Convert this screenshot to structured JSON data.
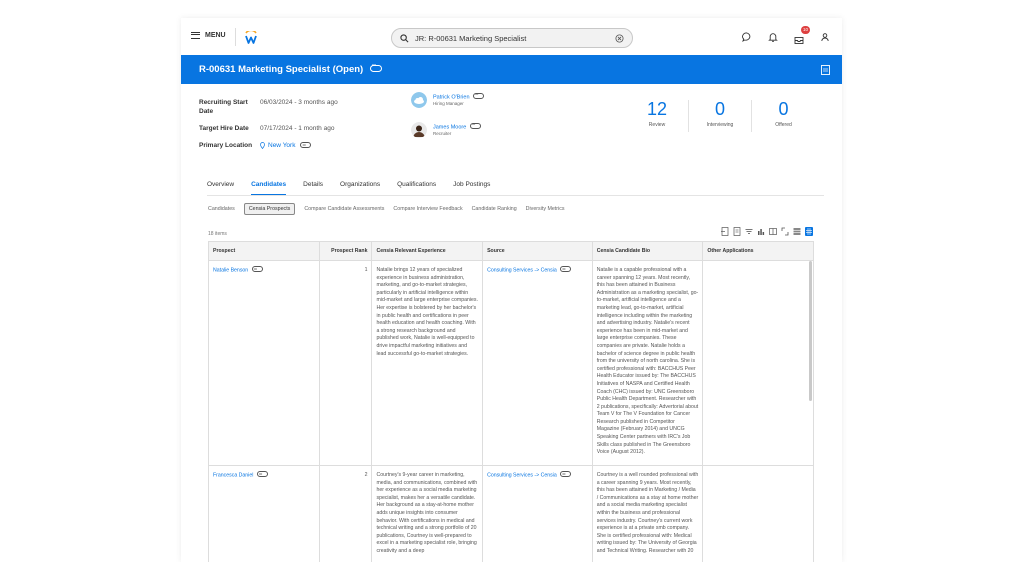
{
  "topnav": {
    "menu_label": "MENU",
    "search_value": "JR: R-00631 Marketing Specialist",
    "inbox_badge": "10"
  },
  "header": {
    "title": "R-00631 Marketing Specialist (Open)"
  },
  "summary": {
    "fields": [
      {
        "label": "Recruiting Start Date",
        "value": "06/03/2024 - 3 months ago"
      },
      {
        "label": "Target Hire Date",
        "value": "07/17/2024 - 1 month ago"
      },
      {
        "label": "Primary Location",
        "value": "New York"
      }
    ],
    "people": [
      {
        "name": "Patrick O'Brien",
        "role": "Hiring Manager"
      },
      {
        "name": "James Moore",
        "role": "Recruiter"
      }
    ],
    "stats": [
      {
        "value": "12",
        "label": "Review"
      },
      {
        "value": "0",
        "label": "Interviewing"
      },
      {
        "value": "0",
        "label": "Offered"
      }
    ]
  },
  "tabs": [
    "Overview",
    "Candidates",
    "Details",
    "Organizations",
    "Qualifications",
    "Job Postings"
  ],
  "active_tab": "Candidates",
  "subtabs": [
    "Candidates",
    "Censia Prospects",
    "Compare Candidate Assessments",
    "Compare Interview Feedback",
    "Candidate Ranking",
    "Diversity Metrics"
  ],
  "active_subtab": "Censia Prospects",
  "table": {
    "items_count": "18 items",
    "columns": [
      "Prospect",
      "Prospect Rank",
      "Censia Relevant Experience",
      "Source",
      "Censia Candidate Bio",
      "Other Applications"
    ],
    "rows": [
      {
        "prospect": "Natalie Benson",
        "rank": "1",
        "experience": "Natalie brings 12 years of specialized experience in business administration, marketing, and go-to-market strategies, particularly in artificial intelligence within mid-market and large enterprise companies. Her expertise is bolstered by her bachelor's in public health and certifications in peer health education and health coaching. With a strong research background and published work, Natalie is well-equipped to drive impactful marketing initiatives and lead successful go-to-market strategies.",
        "source": "Consulting Services -> Censia",
        "bio": "Natalie is a capable professional with a career spanning 12 years. Most recently, this has been attained in Business Administration as a marketing specialist, go-to-market, artificial intelligence and a marketing lead, go-to-market, artificial intelligence including within the marketing and advertising industry. Natalie's recent experience has been in mid-market and large enterprise companies. These companies are private. Natalie holds a bachelor of science degree in public health from the university of north carolina. She is certified professional with: BACCHUS Peer Health Educator issued by: The BACCHUS Initiatives of NASPA and Certified Health Coach (CHC) issued by: UNC Greensboro Public Health Department. Researcher with 2 publications, specifically: Advertorial about Team V for The V Foundation for Cancer Research published in Competitor Magazine (February 2014) and UNCG Speaking Center partners with IRC's Job Skills class published in The Greensboro Voice (August 2012).",
        "other": ""
      },
      {
        "prospect": "Francesca Daniel",
        "rank": "2",
        "experience": "Courtney's 9-year career in marketing, media, and communications, combined with her experience as a social media marketing specialist, makes her a versatile candidate. Her background as a stay-at-home mother adds unique insights into consumer behavior. With certifications in medical and technical writing and a strong portfolio of 20 publications, Courtney is well-prepared to excel in a marketing specialist role, bringing creativity and a deep",
        "source": "Consulting Services -> Censia",
        "bio": "Courtney is a well rounded professional with a career spanning 9 years. Most recently, this has been attained in Marketing / Media / Communications as a stay at home mother and a social media marketing specialist within the business and professional services industry. Courtney's current work experience is at a private smb company. She is certified professional with: Medical writing issued by: The University of Georgia and Technical Writing. Researcher with 20",
        "other": ""
      }
    ]
  }
}
